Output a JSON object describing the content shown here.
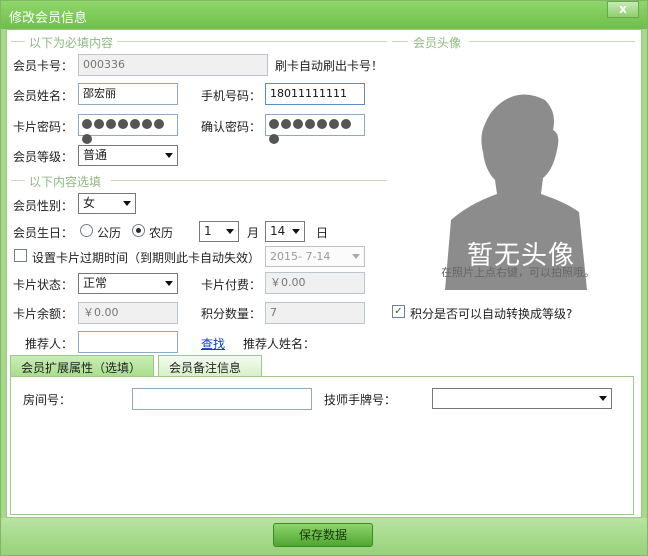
{
  "window": {
    "title": "修改会员信息",
    "close_label": "x"
  },
  "required_section": {
    "title": "以下为必填内容"
  },
  "optional_section": {
    "title": "以下内容选填"
  },
  "avatar_section": {
    "title": "会员头像",
    "placeholder_text": "暂无头像",
    "hint": "在照片上点右键，可以拍照哦。"
  },
  "fields": {
    "card_no_label": "会员卡号：",
    "card_no_value": "000336",
    "swipe_hint": "刷卡自动刷出卡号！",
    "name_label": "会员姓名：",
    "name_value": "邵宏丽",
    "phone_label": "手机号码：",
    "phone_value": "18011111111",
    "card_pwd_label": "卡片密码：",
    "confirm_pwd_label": "确认密码：",
    "level_label": "会员等级：",
    "level_value": "普通",
    "gender_label": "会员性别：",
    "gender_value": "女",
    "birthday_label": "会员生日：",
    "calendar_solar": "公历",
    "calendar_lunar": "农历",
    "birth_month": "1",
    "month_unit": "月",
    "birth_day": "14",
    "day_unit": "日",
    "expire_label": "设置卡片过期时间（到期则此卡自动失效）",
    "expire_date": "2015- 7-14",
    "status_label": "卡片状态：",
    "status_value": "正常",
    "card_fee_label": "卡片付费：",
    "card_fee_value": "￥0.00",
    "balance_label": "卡片余额：",
    "balance_value": "￥0.00",
    "points_label": "积分数量：",
    "points_value": "7",
    "auto_upgrade_label": "积分是否可以自动转换成等级?",
    "referrer_label": "推荐人：",
    "find_link": "查找",
    "referrer_name_label": "推荐人姓名："
  },
  "tabs": [
    {
      "label": "会员扩展属性（选填）"
    },
    {
      "label": "会员备注信息"
    }
  ],
  "ext": {
    "room_label": "房间号：",
    "tech_label": "技师手牌号："
  },
  "footer": {
    "save_label": "保存数据"
  },
  "colors": {
    "accent": "#8fd66a",
    "panel_border": "#9cc986"
  }
}
